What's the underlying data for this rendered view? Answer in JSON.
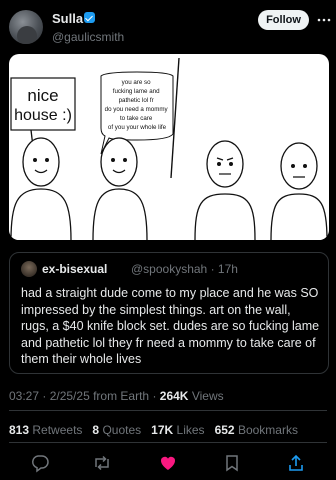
{
  "author": {
    "display_name": "Sulla",
    "handle": "@gaulicsmith",
    "verified": true
  },
  "follow_label": "Follow",
  "media": {
    "sign_text": [
      "nice",
      "house :)"
    ],
    "bubble_lines": [
      "you are so",
      "fucking lame and",
      "pathetic lol fr",
      "do you need a mommy",
      "to take care",
      "of you your whole life"
    ]
  },
  "quote": {
    "name": "ex-bisexual",
    "handle": "@spookyshah",
    "age": "17h",
    "text": "had a straight dude come to my place and he was SO impressed by the simplest things. art on the wall, rugs, a $40 knife block set. dudes are so fucking lame and pathetic lol they fr need a mommy to take care of them their whole lives"
  },
  "meta": {
    "time": "03:27",
    "date": "2/25/25",
    "source": "from Earth",
    "views": "264K",
    "views_label": "Views"
  },
  "stats": {
    "retweets": "813",
    "retweets_label": "Retweets",
    "quotes": "8",
    "quotes_label": "Quotes",
    "likes": "17K",
    "likes_label": "Likes",
    "bookmarks": "652",
    "bookmarks_label": "Bookmarks"
  },
  "colors": {
    "background": "#000000",
    "text": "#e7e9ea",
    "muted": "#71767b",
    "accent": "#1d9bf0",
    "like": "#f91880"
  },
  "icons": [
    "more-icon",
    "verified-icon",
    "reply-icon",
    "retweet-icon",
    "like-icon",
    "bookmark-icon",
    "share-icon"
  ]
}
